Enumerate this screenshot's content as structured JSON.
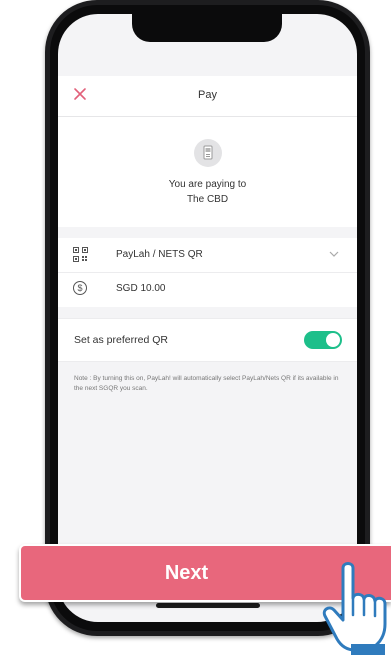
{
  "header": {
    "title": "Pay"
  },
  "merchant": {
    "paying_to": "You are paying to",
    "name": "The CBD"
  },
  "payment_method": {
    "label": "PayLah / NETS QR"
  },
  "amount": {
    "value": "SGD 10.00",
    "currency_symbol": "$"
  },
  "preferred_qr": {
    "label": "Set as preferred QR",
    "enabled": true
  },
  "note": {
    "text": "Note : By turning this on, PayLah! will automatically select PayLah/Nets QR if its available in the next SGQR you scan."
  },
  "next_button": {
    "label": "Next"
  },
  "colors": {
    "accent": "#e8677c",
    "toggle": "#1dbf8a",
    "close": "#e2607a"
  },
  "icons": [
    "close-icon",
    "shop-icon",
    "qr-code-icon",
    "chevron-down-icon",
    "dollar-icon",
    "hand-pointer-icon"
  ]
}
